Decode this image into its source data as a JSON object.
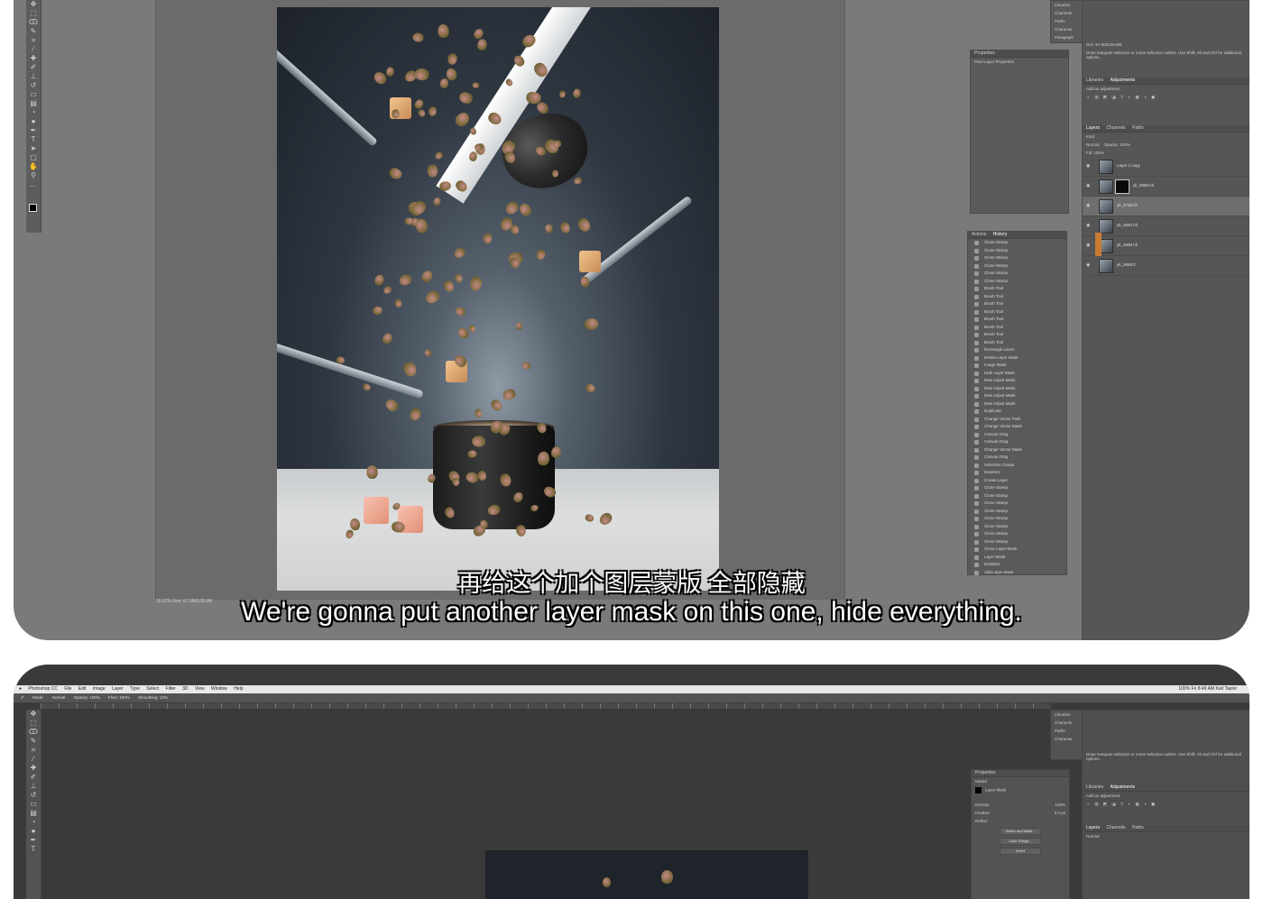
{
  "subtitle": {
    "chinese": "再给这个加个图层蒙版 全部隐藏",
    "english": "We're gonna put another layer mask on this one, hide everything."
  },
  "photoshop_top": {
    "doc_status": "16.67%    Doc: 67.9M/109.6M",
    "right_strip": [
      "Libraries",
      "Channels",
      "Paths",
      "Character",
      "Paragraph"
    ],
    "properties_panel": {
      "title": "Properties",
      "subtitle": "Pixel Layer Properties"
    },
    "history_panel": {
      "tabs": [
        "Actions",
        "History"
      ],
      "items": [
        "Clone Stamp",
        "Clone Stamp",
        "Clone Stamp",
        "Clone Stamp",
        "Clone Stamp",
        "Clone Stamp",
        "Brush Tool",
        "Brush Tool",
        "Brush Tool",
        "Brush Tool",
        "Brush Tool",
        "Brush Tool",
        "Brush Tool",
        "Brush Tool",
        "Rectangle Lasso",
        "Delete Layer Mask",
        "Image Mask",
        "Hide Layer Mask",
        "New Adjust Mask",
        "New Adjust Mask",
        "New Adjust Mask",
        "New Adjust Mask",
        "Duplicate",
        "Change Vector Path",
        "Change Vector Mask",
        "Canvas Drag",
        "Canvas Drag",
        "Change Vector Mask",
        "Canvas Drag",
        "Selection Create",
        "Deselect",
        "Create Layer",
        "Clone Stamp",
        "Clone Stamp",
        "Clone Stamp",
        "Clone Stamp",
        "Clone Stamp",
        "Clone Stamp",
        "Clone Stamp",
        "Clone Stamp",
        "Clone Layer Mask",
        "Layer Mask",
        "Deselect",
        "Add Layer Mask"
      ]
    },
    "adjustments_panel": {
      "tabs": [
        "Libraries",
        "Adjustments"
      ],
      "caption": "Add an adjustment"
    },
    "layers_panel": {
      "tabs": [
        "Layers",
        "Channels",
        "Paths"
      ],
      "kind_label": "Kind",
      "mode": "Normal",
      "opacity_label": "Opacity: 100%",
      "fill_label": "Fill: 100%",
      "layers": [
        {
          "name": "Layer 1 copy",
          "masked": false,
          "selected": false
        },
        {
          "name": "yk_0689 hh",
          "masked": true,
          "selected": false
        },
        {
          "name": "yk_0735 kh",
          "masked": false,
          "selected": true
        },
        {
          "name": "yk_0693 hh",
          "masked": false,
          "selected": false
        },
        {
          "name": "yk_0689 hh",
          "masked": false,
          "selected": false
        },
        {
          "name": "yk_0688 tl",
          "masked": false,
          "selected": false
        }
      ]
    },
    "info_header": "Doc: 67.9M/109.6M",
    "info_note": "Draw marquee selection or move selection outline. Use Shift, Alt and Ctrl for additional options."
  },
  "photoshop_bottom": {
    "menu": [
      "Photoshop CC",
      "File",
      "Edit",
      "Image",
      "Layer",
      "Type",
      "Select",
      "Filter",
      "3D",
      "View",
      "Window",
      "Help"
    ],
    "menu_status": "100%  Fri 8:49 AM  Karl Taylor",
    "options": [
      "Mode:",
      "Normal",
      "Opacity: 100%",
      "Flow: 100%",
      "Smoothing: 10%"
    ],
    "properties_panel": {
      "title": "Properties",
      "mask_label": "Masks",
      "layer_mask_label": "Layer Mask",
      "density_label": "Density:",
      "density_value": "100%",
      "feather_label": "Feather:",
      "feather_value": "0.0 px",
      "refine_label": "Refine:",
      "buttons": [
        "Select and Mask...",
        "Color Range...",
        "Invert"
      ]
    },
    "adjustments_panel": {
      "tabs": [
        "Libraries",
        "Adjustments"
      ],
      "caption": "Add an adjustment"
    },
    "layers_panel": {
      "tabs": [
        "Layers",
        "Channels",
        "Paths"
      ],
      "mode": "Normal"
    }
  }
}
